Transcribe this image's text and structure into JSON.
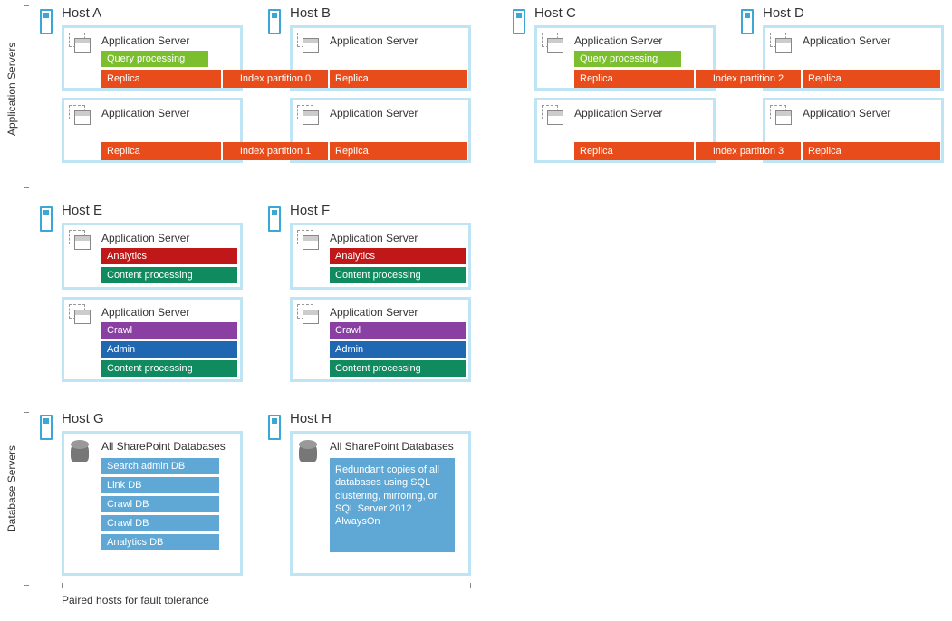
{
  "sections": {
    "app_servers": "Application Servers",
    "db_servers": "Database Servers"
  },
  "caption": "Paired hosts for fault tolerance",
  "hosts": {
    "a": "Host A",
    "b": "Host B",
    "c": "Host C",
    "d": "Host D",
    "e": "Host E",
    "f": "Host F",
    "g": "Host G",
    "h": "Host H"
  },
  "titles": {
    "app_server": "Application Server",
    "all_sp_db": "All SharePoint Databases"
  },
  "components": {
    "query": "Query processing",
    "analytics": "Analytics",
    "content": "Content processing",
    "crawl": "Crawl",
    "admin": "Admin",
    "replica": "Replica"
  },
  "partitions": {
    "p0": "Index partition 0",
    "p1": "Index partition 1",
    "p2": "Index partition 2",
    "p3": "Index partition 3"
  },
  "dbs": {
    "search_admin": "Search admin DB",
    "link": "Link DB",
    "crawl1": "Crawl DB",
    "crawl2": "Crawl DB",
    "analytics": "Analytics DB"
  },
  "redundant_note": "Redundant copies of all databases using SQL clustering, mirroring, or SQL Server 2012 AlwaysOn",
  "colors": {
    "host_border": "#bfe4f4",
    "query": "#7bbf2e",
    "replica": "#e84c1a",
    "analytics": "#c01818",
    "content": "#0f8b5f",
    "crawl": "#8a3fa3",
    "admin": "#1f67b1",
    "db": "#5fa8d6"
  }
}
